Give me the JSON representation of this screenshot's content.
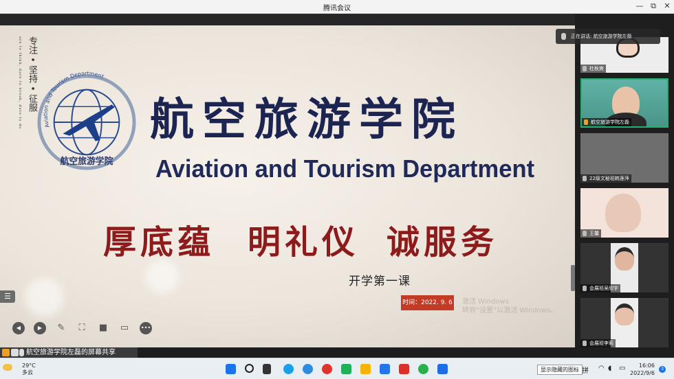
{
  "window": {
    "title": "腾讯会议",
    "minimize": "—",
    "maximize": "⧉",
    "close": "✕"
  },
  "slide": {
    "motto_cn": "专注 • 坚持 • 征服",
    "motto_en": "are to think, dare to break, dare to do",
    "logo_ring_text": "Aviation and Tourism Department",
    "logo_cn_text": "航空旅游学院",
    "title_cn": "航空旅游学院",
    "title_en": "Aviation and Tourism Department",
    "motto_red": [
      "厚底蕴",
      "明礼仪",
      "诚服务"
    ],
    "subtitle": "开学第一课",
    "date": "时间：2022. 9. 6",
    "watermark_line1": "激活 Windows",
    "watermark_line2": "转到“设置”以激活 Windows。",
    "accent_red": "#c43b25",
    "navy": "#1f2a5a"
  },
  "controls": {
    "icons": [
      "prev-icon",
      "play-icon",
      "pen-icon",
      "screenshot-icon",
      "camera-icon",
      "chat-icon",
      "more-icon"
    ],
    "list_icon": "☰"
  },
  "speaking": {
    "label": "正在讲话: 航空旅游学院左磊"
  },
  "share_status": {
    "text": "航空旅游学院左磊的屏幕共享"
  },
  "participants": [
    {
      "name": "杜秋爽"
    },
    {
      "name": "航空旅游学院左磊"
    },
    {
      "name": "22级文秘班韩莲萍"
    },
    {
      "name": "王馨"
    },
    {
      "name": "会展班吴欣宇"
    },
    {
      "name": "会展班李莉"
    }
  ],
  "taskbar": {
    "weather_temp": "29°C",
    "weather_desc": "多云",
    "ime": "拼",
    "tooltip": "显示隐藏的图标",
    "time": "16:06",
    "date": "2022/9/6",
    "notifications": "3"
  }
}
